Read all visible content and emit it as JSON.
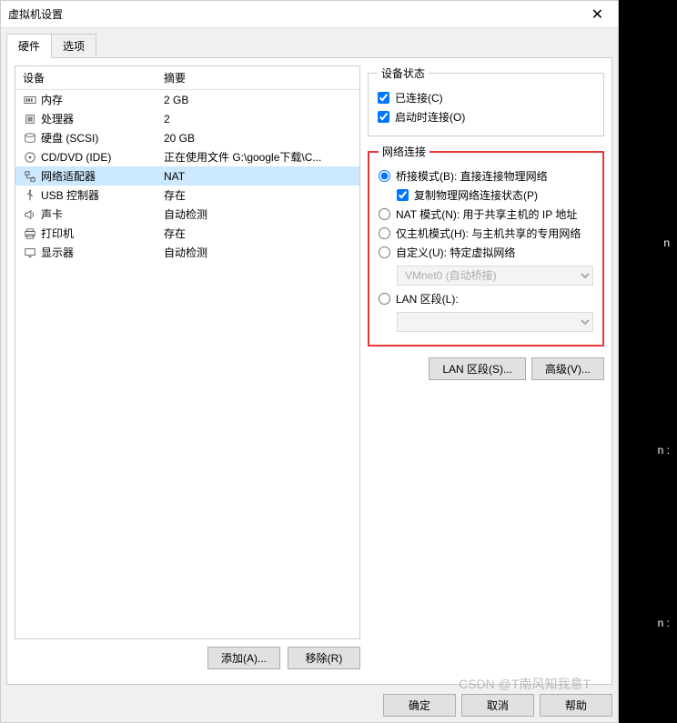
{
  "window": {
    "title": "虚拟机设置"
  },
  "tabs": {
    "hardware": "硬件",
    "options": "选项"
  },
  "headers": {
    "device": "设备",
    "summary": "摘要"
  },
  "devices": [
    {
      "icon": "memory",
      "name": "内存",
      "summary": "2 GB"
    },
    {
      "icon": "cpu",
      "name": "处理器",
      "summary": "2"
    },
    {
      "icon": "disk",
      "name": "硬盘 (SCSI)",
      "summary": "20 GB"
    },
    {
      "icon": "disc",
      "name": "CD/DVD (IDE)",
      "summary": "正在使用文件 G:\\google下载\\C..."
    },
    {
      "icon": "network",
      "name": "网络适配器",
      "summary": "NAT"
    },
    {
      "icon": "usb",
      "name": "USB 控制器",
      "summary": "存在"
    },
    {
      "icon": "sound",
      "name": "声卡",
      "summary": "自动检测"
    },
    {
      "icon": "printer",
      "name": "打印机",
      "summary": "存在"
    },
    {
      "icon": "display",
      "name": "显示器",
      "summary": "自动检测"
    }
  ],
  "leftButtons": {
    "add": "添加(A)...",
    "remove": "移除(R)"
  },
  "deviceStatus": {
    "legend": "设备状态",
    "connected": "已连接(C)",
    "connectOnStart": "启动时连接(O)"
  },
  "networkConn": {
    "legend": "网络连接",
    "bridged": "桥接模式(B): 直接连接物理网络",
    "replicate": "复制物理网络连接状态(P)",
    "nat": "NAT 模式(N): 用于共享主机的 IP 地址",
    "hostonly": "仅主机模式(H): 与主机共享的专用网络",
    "custom": "自定义(U): 特定虚拟网络",
    "customSelect": "VMnet0 (自动桥接)",
    "lan": "LAN 区段(L):"
  },
  "rightButtons": {
    "lanSeg": "LAN 区段(S)...",
    "advanced": "高级(V)..."
  },
  "footer": {
    "ok": "确定",
    "cancel": "取消",
    "help": "帮助"
  },
  "watermark": "CSDN @T南风知我意T"
}
